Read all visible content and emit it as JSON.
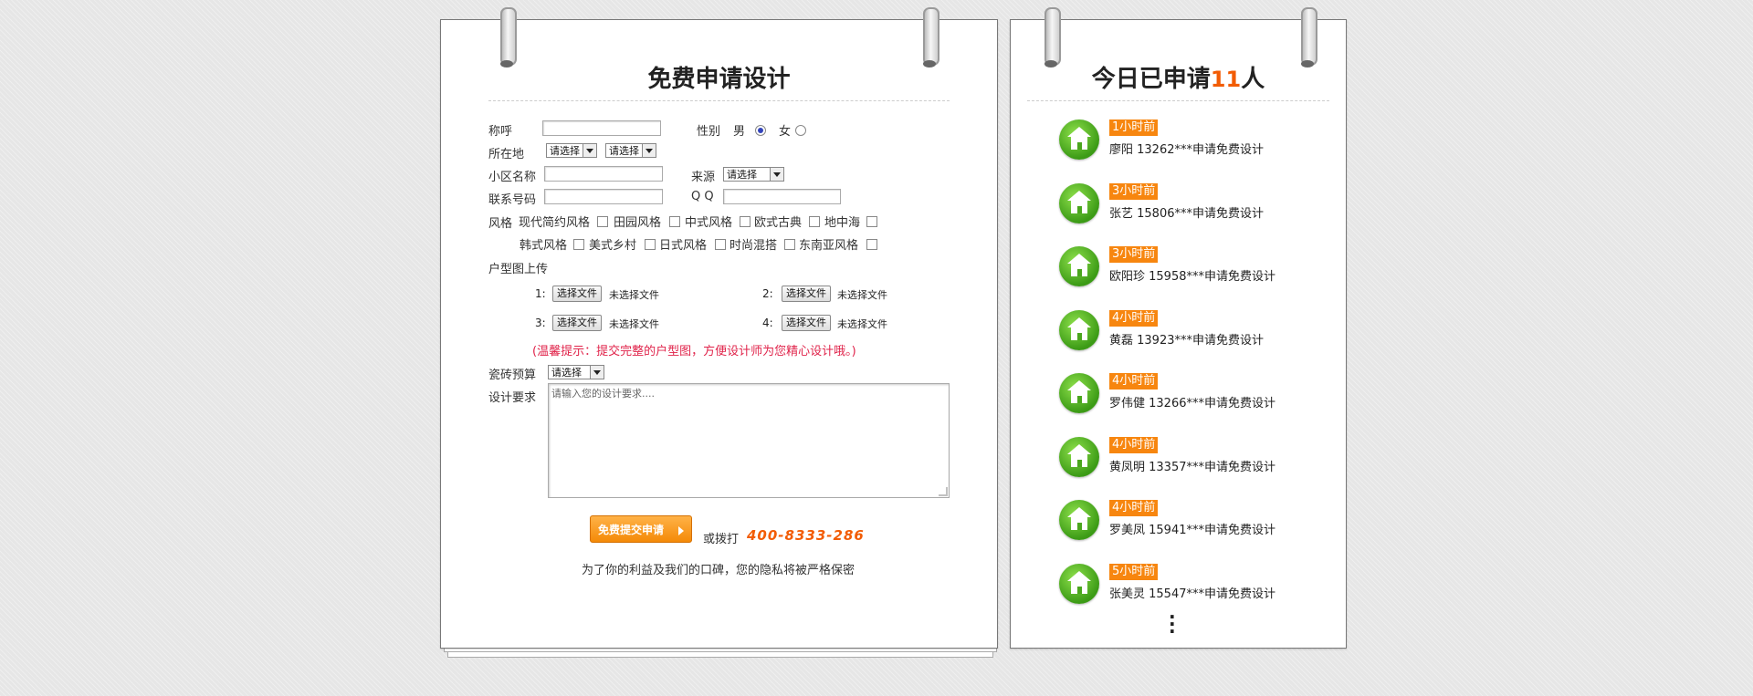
{
  "left_card": {
    "title": "免费申请设计",
    "fields": {
      "salutation_label": "称呼",
      "gender_label": "性别",
      "gender_male": "男",
      "gender_female": "女",
      "location_label": "所在地",
      "location_select_1": "请选择",
      "location_select_2": "请选择",
      "community_label": "小区名称",
      "source_label": "来源",
      "source_select": "请选择",
      "phone_label": "联系号码",
      "qq_label": "Q Q"
    },
    "style_label": "风格",
    "styles_row1": [
      "现代简约风格",
      "田园风格",
      "中式风格",
      "欧式古典",
      "地中海"
    ],
    "styles_row2": [
      "韩式风格",
      "美式乡村",
      "日式风格",
      "时尚混搭",
      "东南亚风格"
    ],
    "floorplan_label": "户型图上传",
    "uploads": [
      {
        "num": "1:",
        "button": "选择文件",
        "status": "未选择文件"
      },
      {
        "num": "2:",
        "button": "选择文件",
        "status": "未选择文件"
      },
      {
        "num": "3:",
        "button": "选择文件",
        "status": "未选择文件"
      },
      {
        "num": "4:",
        "button": "选择文件",
        "status": "未选择文件"
      }
    ],
    "tip": "(温馨提示：提交完整的户型图，方便设计师为您精心设计哦。)",
    "budget_label": "瓷砖预算",
    "budget_select": "请选择",
    "requirement_label": "设计要求",
    "requirement_placeholder": "请输入您的设计要求....",
    "submit_label": "免费提交申请",
    "or_call": "或拨打",
    "phone_number": "400-8333-286",
    "privacy": "为了你的利益及我们的口碑，您的隐私将被严格保密"
  },
  "right_card": {
    "title_prefix": "今日已申请",
    "title_count": "11",
    "title_suffix": "人",
    "entries": [
      {
        "time": "1小时前",
        "text": "廖阳 13262***申请免费设计"
      },
      {
        "time": "3小时前",
        "text": "张艺 15806***申请免费设计"
      },
      {
        "time": "3小时前",
        "text": "欧阳珍 15958***申请免费设计"
      },
      {
        "time": "4小时前",
        "text": "黄磊 13923***申请免费设计"
      },
      {
        "time": "4小时前",
        "text": "罗伟健 13266***申请免费设计"
      },
      {
        "time": "4小时前",
        "text": "黄凤明 13357***申请免费设计"
      },
      {
        "time": "4小时前",
        "text": "罗美凤 15941***申请免费设计"
      },
      {
        "time": "5小时前",
        "text": "张美灵 15547***申请免费设计"
      }
    ],
    "more": "⋮"
  },
  "colors": {
    "accent": "#f25c05",
    "badge": "#f7860f",
    "tip": "#e0234a",
    "house_green": "#3c9b16"
  }
}
